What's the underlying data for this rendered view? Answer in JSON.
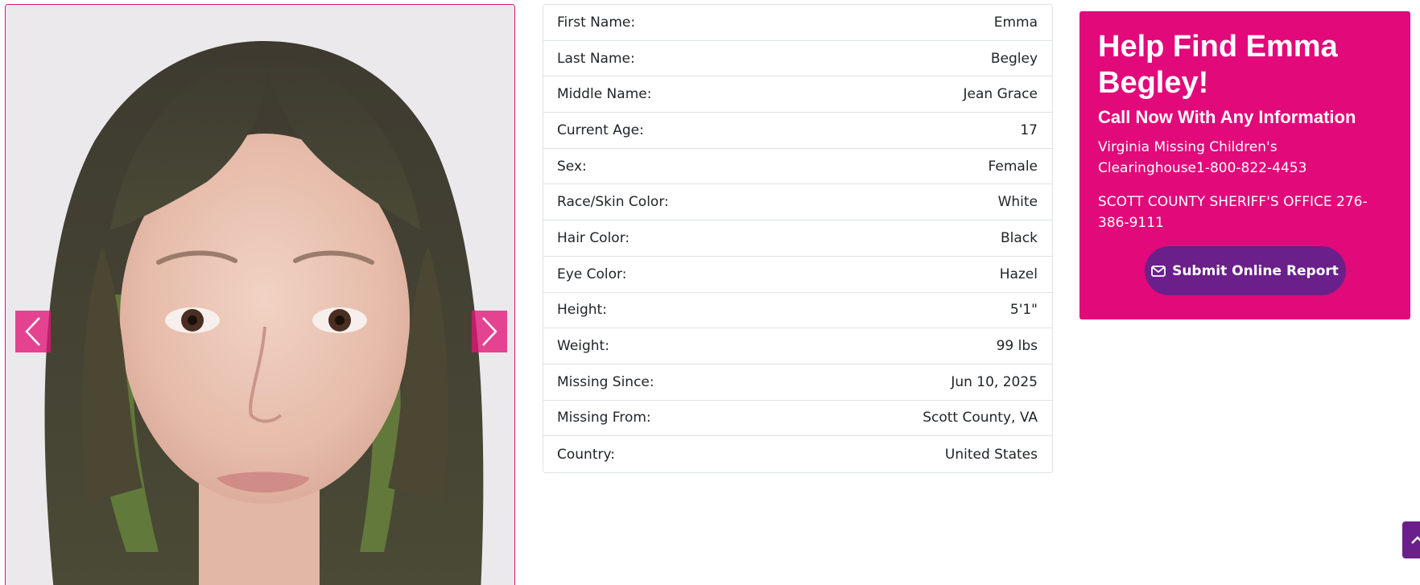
{
  "photo": {
    "alt": "Emma Begley"
  },
  "carousel": {
    "prev_icon": "chevron-left-icon",
    "next_icon": "chevron-right-icon"
  },
  "details": [
    {
      "label": "First Name:",
      "value": "Emma"
    },
    {
      "label": "Last Name:",
      "value": "Begley"
    },
    {
      "label": "Middle Name:",
      "value": "Jean Grace"
    },
    {
      "label": "Current Age:",
      "value": "17"
    },
    {
      "label": "Sex:",
      "value": "Female"
    },
    {
      "label": "Race/Skin Color:",
      "value": "White"
    },
    {
      "label": "Hair Color:",
      "value": "Black"
    },
    {
      "label": "Eye Color:",
      "value": "Hazel"
    },
    {
      "label": "Height:",
      "value": "5'1\""
    },
    {
      "label": "Weight:",
      "value": "99 lbs"
    },
    {
      "label": "Missing Since:",
      "value": "Jun 10, 2025"
    },
    {
      "label": "Missing From:",
      "value": "Scott County, VA"
    },
    {
      "label": "Country:",
      "value": "United States"
    }
  ],
  "help": {
    "title": "Help Find Emma Begley!",
    "subtitle": "Call Now With Any Information",
    "contact_1": "Virginia Missing Children's Clearinghouse1-800-822-4453",
    "contact_2": "SCOTT COUNTY SHERIFF'S OFFICE 276-386-9111",
    "submit_label": "Submit Online Report",
    "submit_icon": "envelope-icon"
  },
  "back_to_top": {
    "icon": "chevron-up-icon"
  },
  "colors": {
    "brand_pink": "#e2097a",
    "brand_purple": "#6b1f8a",
    "border": "#dee2e6"
  }
}
